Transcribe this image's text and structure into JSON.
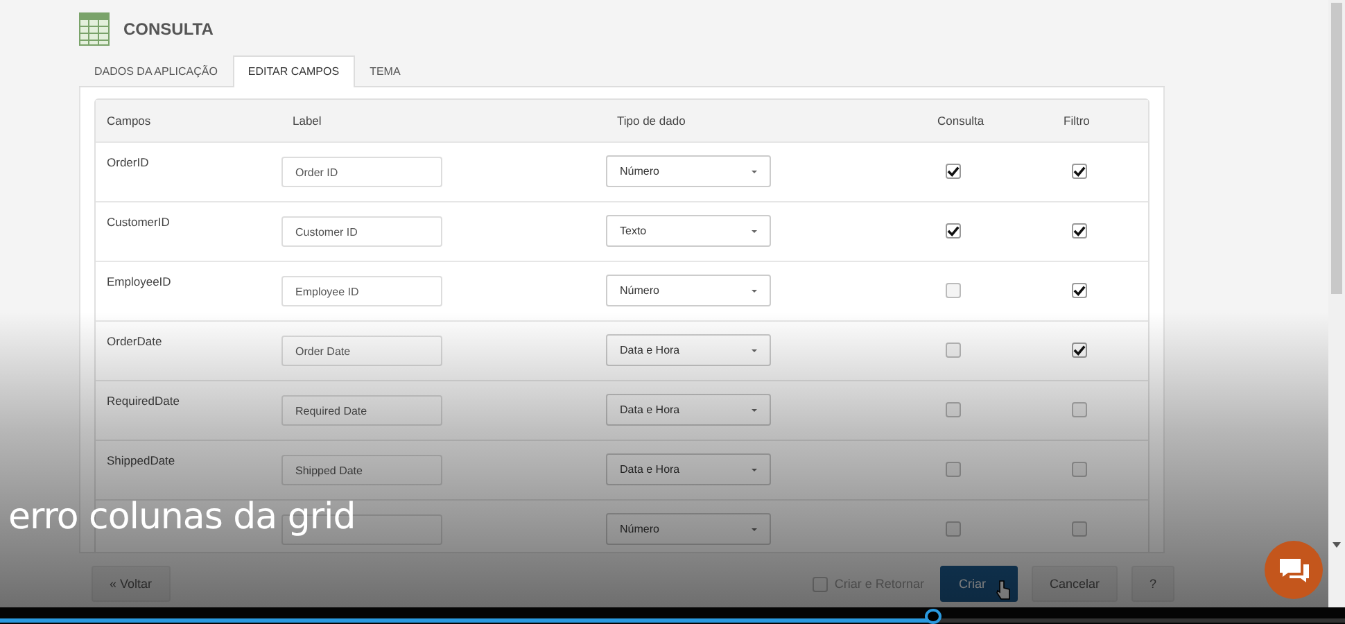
{
  "app": {
    "title": "CONSULTA"
  },
  "tabs": [
    {
      "label": "DADOS DA APLICAÇÃO",
      "selected": false
    },
    {
      "label": "EDITAR CAMPOS",
      "selected": true
    },
    {
      "label": "TEMA",
      "selected": false
    }
  ],
  "table": {
    "columns": [
      "Campos",
      "Label",
      "Tipo de dado",
      "Consulta",
      "Filtro"
    ],
    "rows": [
      {
        "field": "OrderID",
        "label": "Order ID",
        "type": "Número",
        "consulta": true,
        "filtro": true
      },
      {
        "field": "CustomerID",
        "label": "Customer ID",
        "type": "Texto",
        "consulta": true,
        "filtro": true
      },
      {
        "field": "EmployeeID",
        "label": "Employee ID",
        "type": "Número",
        "consulta": false,
        "filtro": true
      },
      {
        "field": "OrderDate",
        "label": "Order Date",
        "type": "Data e Hora",
        "consulta": false,
        "filtro": true
      },
      {
        "field": "RequiredDate",
        "label": "Required Date",
        "type": "Data e Hora",
        "consulta": false,
        "filtro": false
      },
      {
        "field": "ShippedDate",
        "label": "Shipped Date",
        "type": "Data e Hora",
        "consulta": false,
        "filtro": false
      },
      {
        "type": "Número",
        "consulta": false,
        "filtro": false
      }
    ]
  },
  "footer": {
    "back": "« Voltar",
    "create_return": {
      "label": "Criar e Retornar",
      "checked": false
    },
    "buttons": [
      "Criar",
      "Cancelar",
      "?"
    ]
  },
  "video": {
    "caption": "erro colunas da grid",
    "progress": {
      "level": 0.694
    }
  }
}
